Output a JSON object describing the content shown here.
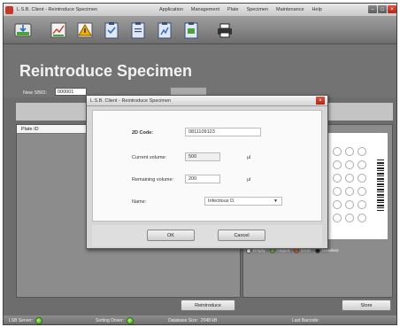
{
  "window": {
    "title": "L.S.B. Client - Reintroduce Specimen",
    "menu": [
      "Application",
      "Management",
      "Plate",
      "Specimen",
      "Maintenance",
      "Help"
    ]
  },
  "toolbar": {
    "buttons": [
      "specimen-import",
      "chart",
      "warning",
      "clipboard-check",
      "clipboard",
      "clipboard-chart",
      "clipboard-flag",
      "printer"
    ]
  },
  "header": {
    "title": "Reintroduce Specimen",
    "new_sbid_label": "New SBID:",
    "new_sbid_value": "000001"
  },
  "left_panel": {
    "column_header": "Plate ID"
  },
  "dialog": {
    "title": "L.S.B. Client - Reintroduce Specimen",
    "code_label": "2D Code:",
    "code_value": "0811109123",
    "current_volume_label": "Current volume:",
    "current_volume_value": "500",
    "current_volume_unit": "µl",
    "remaining_volume_label": "Remaining volume:",
    "remaining_volume_value": "200",
    "remaining_volume_unit": "µl",
    "name_label": "Name:",
    "name_value": "Infectious D.",
    "ok_label": "OK",
    "cancel_label": "Cancel"
  },
  "legend": [
    {
      "label": "Empty",
      "color": "#ffffff"
    },
    {
      "label": "Aliquot",
      "color": "#6cc23a"
    },
    {
      "label": "Error",
      "color": "#e8652b"
    },
    {
      "label": "Deselect",
      "color": "#222222"
    }
  ],
  "buttons": {
    "reintroduce": "Reintroduce",
    "store": "Store"
  },
  "status": {
    "server_label": "LSB Server:",
    "sorting_label": "Sorting Driver:",
    "database_label": "Database Size:",
    "database_value": "2048 kB",
    "barcode_label": "Last Barcode:"
  }
}
